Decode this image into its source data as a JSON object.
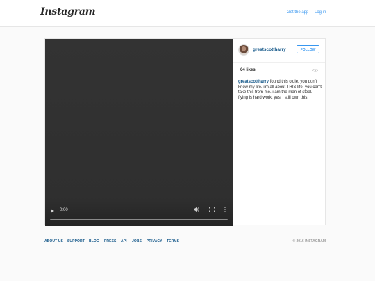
{
  "topbar": {
    "logo": "Instagram",
    "get_app": "Get the app",
    "login": "Log in"
  },
  "video": {
    "time": "0:00",
    "progress_fraction": 0
  },
  "post": {
    "username": "greatscottharry",
    "follow_label": "FOLLOW",
    "likes": "64 likes",
    "caption_user": "greatscottharry",
    "caption_text": " found this oldie. you don't know my life. i'm all about THIS life. you can't take this from me. i am the man of steal. flying is hard work. yes, i still own this."
  },
  "footer": {
    "links": [
      "ABOUT US",
      "SUPPORT",
      "BLOG",
      "PRESS",
      "API",
      "JOBS",
      "PRIVACY",
      "TERMS"
    ],
    "copyright": "© 2016 INSTAGRAM"
  },
  "colors": {
    "link": "#3897f0",
    "username": "#125688",
    "video_bg": "#333333"
  }
}
